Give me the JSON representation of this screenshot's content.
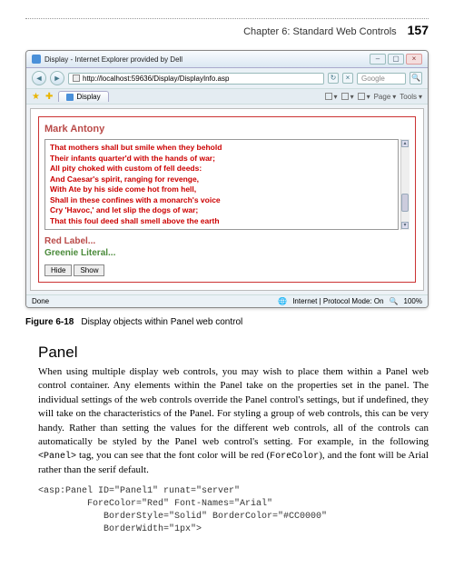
{
  "header": {
    "chapter": "Chapter 6:   Standard Web Controls",
    "page": "157"
  },
  "browser": {
    "title": "Display - Internet Explorer provided by Dell",
    "url": "http://localhost:59636/Display/DisplayInfo.asp",
    "search_placeholder": "Google",
    "tab_label": "Display",
    "tool_home": "",
    "tool_feed": "",
    "tool_print": "",
    "tool_page": "Page",
    "tool_tools": "Tools"
  },
  "panel": {
    "name": "Mark Antony",
    "poem": [
      "That mothers shall but smile when they behold",
      "Their infants quarter'd with the hands of war;",
      "All pity choked with custom of fell deeds:",
      "And Caesar's spirit, ranging for revenge,",
      "With Ate by his side come hot from hell,",
      "Shall in these confines with a monarch's voice",
      "Cry 'Havoc,' and let slip the dogs of war;",
      "That this foul deed shall smell above the earth"
    ],
    "red_label": "Red Label...",
    "green_literal": "Greenie Literal...",
    "hide": "Hide",
    "show": "Show"
  },
  "statusbar": {
    "done": "Done",
    "zone": "Internet | Protocol Mode: On",
    "zoom": "100%"
  },
  "caption": {
    "fig": "Figure 6-18",
    "text": "Display objects within Panel web control"
  },
  "section": {
    "title": "Panel",
    "body_1": "When using multiple display web controls, you may wish to place them within a Panel web control container. Any elements within the Panel take on the properties set in the panel. The individual settings of the web controls override the Panel control's settings, but if undefined, they will take on the characteristics of the Panel. For styling a group of web controls, this can be very handy. Rather than setting the values for the different web controls, all of the controls can automatically be styled by the Panel web control's setting. For example, in the following ",
    "body_code1": "<Panel>",
    "body_2": " tag, you can see that the font color will be red (",
    "body_code2": "ForeColor",
    "body_3": "), and the font will be Arial rather than the serif default."
  },
  "codeblock": "<asp:Panel ID=\"Panel1\" runat=\"server\"\n         ForeColor=\"Red\" Font-Names=\"Arial\"\n            BorderStyle=\"Solid\" BorderColor=\"#CC0000\"\n            BorderWidth=\"1px\">"
}
